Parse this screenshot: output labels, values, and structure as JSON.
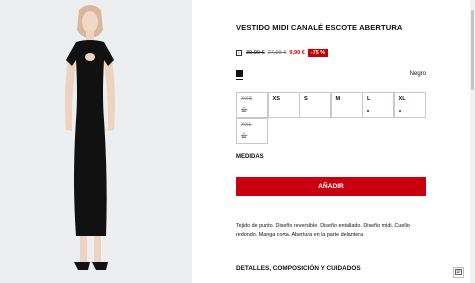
{
  "product": {
    "title": "VESTIDO MIDI CANALÉ ESCOTE ABERTURA",
    "price_original": "39,99 €",
    "price_previous": "27,99 €",
    "price_current": "9,90 €",
    "discount": "-75 %",
    "color_name": "Negro",
    "swatch_color": "#111111"
  },
  "sizes": [
    {
      "label": "XXS",
      "available": false
    },
    {
      "label": "XS",
      "available": true
    },
    {
      "label": "S",
      "available": true
    },
    {
      "label": "M",
      "available": true
    },
    {
      "label": "L",
      "available": true,
      "dot_color": "#333333"
    },
    {
      "label": "XL",
      "available": true,
      "dot_color": "#d40000"
    },
    {
      "label": "XXL",
      "available": false
    }
  ],
  "labels": {
    "measures": "MEDIDAS",
    "add_button": "AÑADIR",
    "description": "Tejido de punto. Diseño reversible. Diseño entallado. Diseño midi. Cuello redondo. Manga corta. Abertura en la parte delantera",
    "details_heading": "DETALLES, COMPOSICIÓN Y CUIDADOS"
  },
  "colors": {
    "accent": "#c8000f",
    "sale": "#d40000"
  },
  "icons": {
    "price_info": "info-square-icon",
    "notify": "bell-icon",
    "chat": "chat-icon"
  }
}
